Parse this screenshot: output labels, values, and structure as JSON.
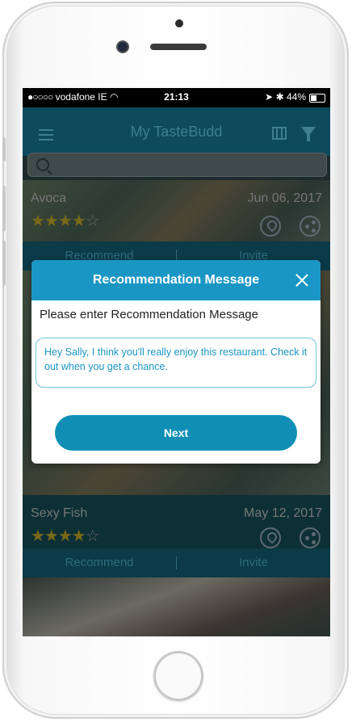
{
  "status_bar": {
    "carrier": "vodafone IE",
    "time": "21:13",
    "battery": "44%",
    "battery_level": 0.44
  },
  "app": {
    "title": "My TasteBudd",
    "search_placeholder": ""
  },
  "restaurants": [
    {
      "name": "Avoca",
      "date": "Jun 06, 2017",
      "rating": 4,
      "recommend_label": "Recommend",
      "invite_label": "Invite"
    },
    {
      "name": "Sexy Fish",
      "date": "May 12, 2017",
      "rating": 4,
      "recommend_label": "Recommend",
      "invite_label": "Invite"
    }
  ],
  "modal": {
    "title": "Recommendation  Message",
    "prompt": "Please enter Recommendation  Message",
    "message": "Hey Sally, I think you'll really enjoy this restaurant. Check it out when you get a chance.",
    "next_label": "Next"
  },
  "colors": {
    "modal_header": "#1a96c4",
    "next_button": "#0f8fb6",
    "appbar_dimmed": "#0c4a5e"
  }
}
